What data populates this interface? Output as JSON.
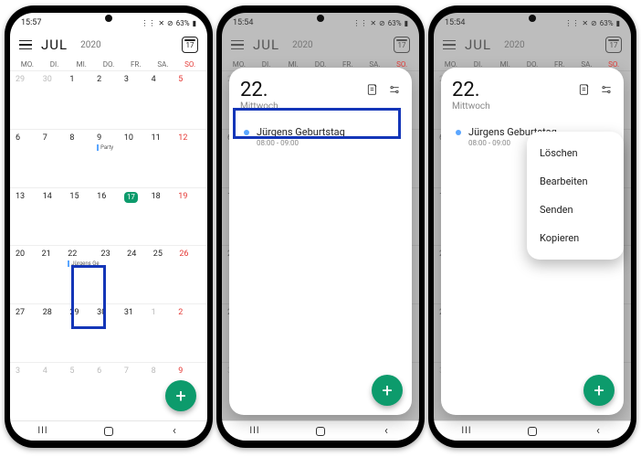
{
  "status": {
    "t1": "15:57",
    "t2": "15:54",
    "t3": "15:54",
    "batt": "63%"
  },
  "header": {
    "month": "JUL",
    "year": "2020",
    "today": "17"
  },
  "dow": [
    "MO.",
    "DI.",
    "MI.",
    "DO.",
    "FR.",
    "SA.",
    "SO."
  ],
  "grid": [
    [
      {
        "n": "29",
        "o": true
      },
      {
        "n": "30",
        "o": true
      },
      {
        "n": "1"
      },
      {
        "n": "2"
      },
      {
        "n": "3"
      },
      {
        "n": "4"
      },
      {
        "n": "5",
        "sun": true
      }
    ],
    [
      {
        "n": "6"
      },
      {
        "n": "7"
      },
      {
        "n": "8"
      },
      {
        "n": "9",
        "ev": "Party"
      },
      {
        "n": "10"
      },
      {
        "n": "11"
      },
      {
        "n": "12",
        "sun": true
      }
    ],
    [
      {
        "n": "13"
      },
      {
        "n": "14"
      },
      {
        "n": "15"
      },
      {
        "n": "16"
      },
      {
        "n": "17",
        "today": true
      },
      {
        "n": "18"
      },
      {
        "n": "19",
        "sun": true
      }
    ],
    [
      {
        "n": "20"
      },
      {
        "n": "21"
      },
      {
        "n": "22",
        "ev": "Jürgens Ge"
      },
      {
        "n": "23"
      },
      {
        "n": "24"
      },
      {
        "n": "25"
      },
      {
        "n": "26",
        "sun": true
      }
    ],
    [
      {
        "n": "27"
      },
      {
        "n": "28"
      },
      {
        "n": "29"
      },
      {
        "n": "30"
      },
      {
        "n": "31"
      },
      {
        "n": "1",
        "o": true
      },
      {
        "n": "2",
        "o": true,
        "sun": true
      }
    ],
    [
      {
        "n": "3",
        "o": true
      },
      {
        "n": "4",
        "o": true
      },
      {
        "n": "5",
        "o": true
      },
      {
        "n": "6",
        "o": true
      },
      {
        "n": "7",
        "o": true
      },
      {
        "n": "8",
        "o": true
      },
      {
        "n": "9",
        "o": true,
        "sun": true
      }
    ]
  ],
  "card": {
    "date": "22.",
    "weekday": "Mittwoch",
    "event_title": "Jürgens Geburtstag",
    "event_time": "08:00 - 09:00"
  },
  "ctx": {
    "delete": "Löschen",
    "edit": "Bearbeiten",
    "send": "Senden",
    "copy": "Kopieren"
  },
  "fab": "+"
}
